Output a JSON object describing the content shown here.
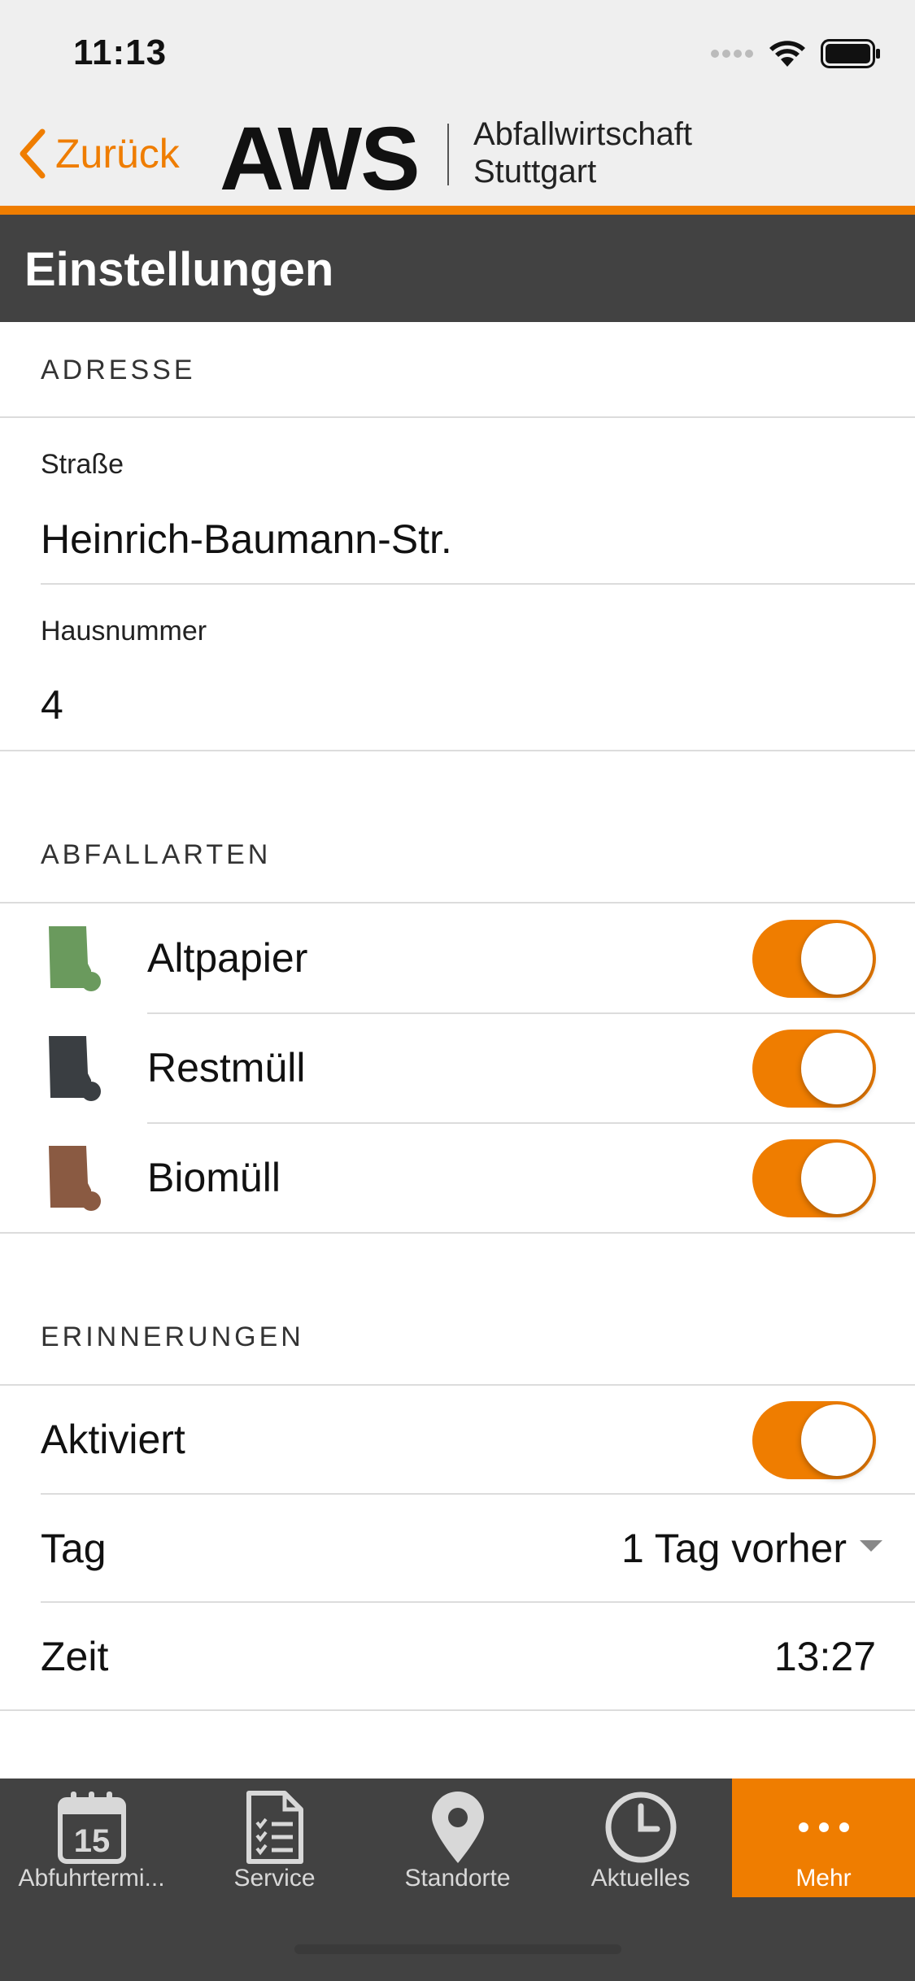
{
  "status_bar": {
    "time": "11:13"
  },
  "header": {
    "back_label": "Zurück",
    "logo_text": "AWS",
    "logo_sub_line1": "Abfallwirtschaft",
    "logo_sub_line2": "Stuttgart"
  },
  "page_title": "Einstellungen",
  "address": {
    "section_title": "ADRESSE",
    "street_label": "Straße",
    "street_value": "Heinrich-Baumann-Str.",
    "number_label": "Hausnummer",
    "number_value": "4"
  },
  "waste_types": {
    "section_title": "ABFALLARTEN",
    "items": [
      {
        "label": "Altpapier",
        "enabled": true,
        "color": "#6a9a5d"
      },
      {
        "label": "Restmüll",
        "enabled": true,
        "color": "#3a3e42"
      },
      {
        "label": "Biomüll",
        "enabled": true,
        "color": "#8a5a42"
      }
    ]
  },
  "reminders": {
    "section_title": "ERINNERUNGEN",
    "activated_label": "Aktiviert",
    "activated": true,
    "day_label": "Tag",
    "day_value": "1 Tag vorher",
    "time_label": "Zeit",
    "time_value": "13:27"
  },
  "tabbar": {
    "tabs": [
      {
        "label": "Abfuhrtermi...",
        "icon": "calendar-icon",
        "calendar_day": "15"
      },
      {
        "label": "Service",
        "icon": "checklist-icon"
      },
      {
        "label": "Standorte",
        "icon": "location-pin-icon"
      },
      {
        "label": "Aktuelles",
        "icon": "clock-icon"
      },
      {
        "label": "Mehr",
        "icon": "more-dots-icon",
        "active": true
      }
    ]
  },
  "colors": {
    "accent": "#ef7d00",
    "dark_bar": "#424242",
    "header_bg": "#efefef"
  }
}
